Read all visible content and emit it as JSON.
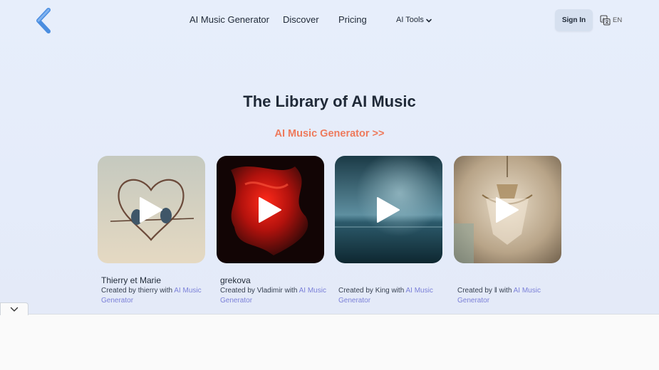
{
  "header": {
    "nav": [
      {
        "label": "AI Music Generator"
      },
      {
        "label": "Discover"
      },
      {
        "label": "Pricing"
      },
      {
        "label": "AI Tools"
      }
    ],
    "sign_in": "Sign In",
    "language": "EN"
  },
  "hero": {
    "title": "The Library of AI Music",
    "subtitle": "AI Music Generator >>"
  },
  "cards": [
    {
      "title": "Thierry et Marie",
      "credit_prefix": "Created by thierry with ",
      "credit_link": "AI Music Generator",
      "icon": "play-icon"
    },
    {
      "title": "grekova",
      "credit_prefix": "Created by Vladimir with ",
      "credit_link": "AI Music Generator",
      "icon": "play-icon"
    },
    {
      "title": "",
      "credit_prefix": "Created by King with ",
      "credit_link": "AI Music Generator",
      "icon": "play-icon"
    },
    {
      "title": "",
      "credit_prefix": "Created by ‖ with ",
      "credit_link": "AI Music Generator",
      "icon": "play-icon"
    }
  ],
  "colors": {
    "accent": "#ee7a5c",
    "link": "#7b80d8",
    "logo": "#4a8de0"
  }
}
